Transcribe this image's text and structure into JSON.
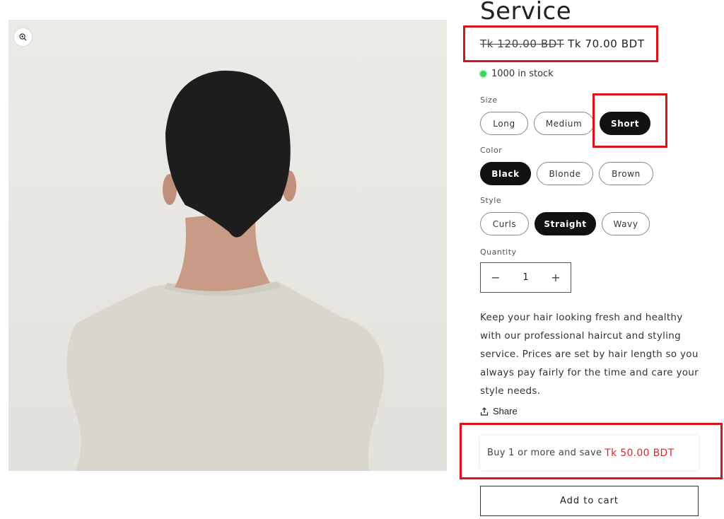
{
  "product": {
    "title": "Service",
    "price_original": "Tk 120.00 BDT",
    "price_sale": "Tk 70.00 BDT",
    "stock_text": "1000 in stock"
  },
  "options": {
    "size": {
      "label": "Size",
      "values": [
        "Long",
        "Medium",
        "Short"
      ],
      "selected": "Short"
    },
    "color": {
      "label": "Color",
      "values": [
        "Black",
        "Blonde",
        "Brown"
      ],
      "selected": "Black"
    },
    "style": {
      "label": "Style",
      "values": [
        "Curls",
        "Straight",
        "Wavy"
      ],
      "selected": "Straight"
    }
  },
  "quantity": {
    "label": "Quantity",
    "value": "1",
    "decrease": "−",
    "increase": "+"
  },
  "description": "Keep your hair looking fresh and healthy with our professional haircut and styling service. Prices are set by hair length so you always pay fairly for the time and care your style needs.",
  "share_label": "Share",
  "offer": {
    "text": "Buy 1 or more and save",
    "amount": "Tk 50.00 BDT"
  },
  "add_to_cart": "Add to cart",
  "colors": {
    "highlight": "#d5141b",
    "offer_red": "#e0262a",
    "stock_dot": "#3cd65a",
    "selected_pill": "#111111"
  },
  "icons": {
    "zoom": "zoom-in-icon",
    "share": "share-icon"
  }
}
